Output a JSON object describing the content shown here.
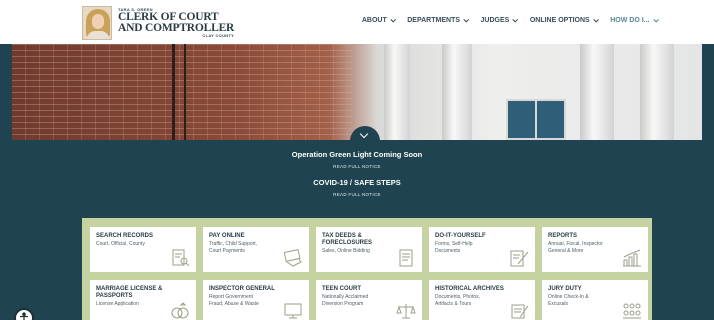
{
  "header": {
    "logo": {
      "name": "TARA S. GREEN",
      "title_line1": "CLERK OF COURT",
      "title_line2": "AND COMPTROLLER",
      "county": "CLAY COUNTY"
    },
    "nav": [
      {
        "label": "ABOUT",
        "active": false
      },
      {
        "label": "DEPARTMENTS",
        "active": false
      },
      {
        "label": "JUDGES",
        "active": false
      },
      {
        "label": "ONLINE OPTIONS",
        "active": false
      },
      {
        "label": "HOW DO I...",
        "active": true
      }
    ]
  },
  "notices": [
    {
      "title": "Operation Green Light Coming Soon",
      "link": "READ FULL NOTICE"
    },
    {
      "title": "COVID-19 / SAFE STEPS",
      "link": "READ FULL NOTICE"
    }
  ],
  "cards": [
    {
      "title": [
        "SEARCH RECORDS"
      ],
      "sub": [
        "Court, Official, County"
      ],
      "icon": "document-search-icon"
    },
    {
      "title": [
        "PAY ONLINE"
      ],
      "sub": [
        "Traffic, Child Support,",
        "Court Payments"
      ],
      "icon": "payment-card-icon"
    },
    {
      "title": [
        "TAX DEEDS &",
        "FORECLOSURES"
      ],
      "sub": [
        "Sales, Online Bidding"
      ],
      "icon": "deed-document-icon"
    },
    {
      "title": [
        "DO-IT-YOURSELF"
      ],
      "sub": [
        "Forms, Self-Help",
        "Documents"
      ],
      "icon": "form-pencil-icon"
    },
    {
      "title": [
        "REPORTS"
      ],
      "sub": [
        "Annual, Fiscal, Inspector",
        "General & More"
      ],
      "icon": "bar-chart-icon"
    },
    {
      "title": [
        "MARRIAGE LICENSE &",
        "PASSPORTS"
      ],
      "sub": [
        "License Application"
      ],
      "icon": "rings-icon"
    },
    {
      "title": [
        "INSPECTOR GENERAL"
      ],
      "sub": [
        "Report Government",
        "Fraud, Abuse & Waste"
      ],
      "icon": "monitor-icon"
    },
    {
      "title": [
        "TEEN COURT"
      ],
      "sub": [
        "Nationally Acclaimed",
        "Diversion Program"
      ],
      "icon": "scales-icon"
    },
    {
      "title": [
        "HISTORICAL ARCHIVES"
      ],
      "sub": [
        "Documents, Photos,",
        "Artifacts & Tours"
      ],
      "icon": "archive-scroll-icon"
    },
    {
      "title": [
        "JURY DUTY"
      ],
      "sub": [
        "Online Check-In &",
        "Excusals"
      ],
      "icon": "jury-people-icon"
    }
  ],
  "colors": {
    "header_bg": "#ffffff",
    "main_bg": "#1f4350",
    "panel_bg": "#c5d3a1",
    "card_bg": "#ffffff",
    "icon_stroke": "#9aa08a",
    "nav_active": "#5a8797"
  },
  "accessibility": {
    "icon": "accessibility-icon"
  }
}
